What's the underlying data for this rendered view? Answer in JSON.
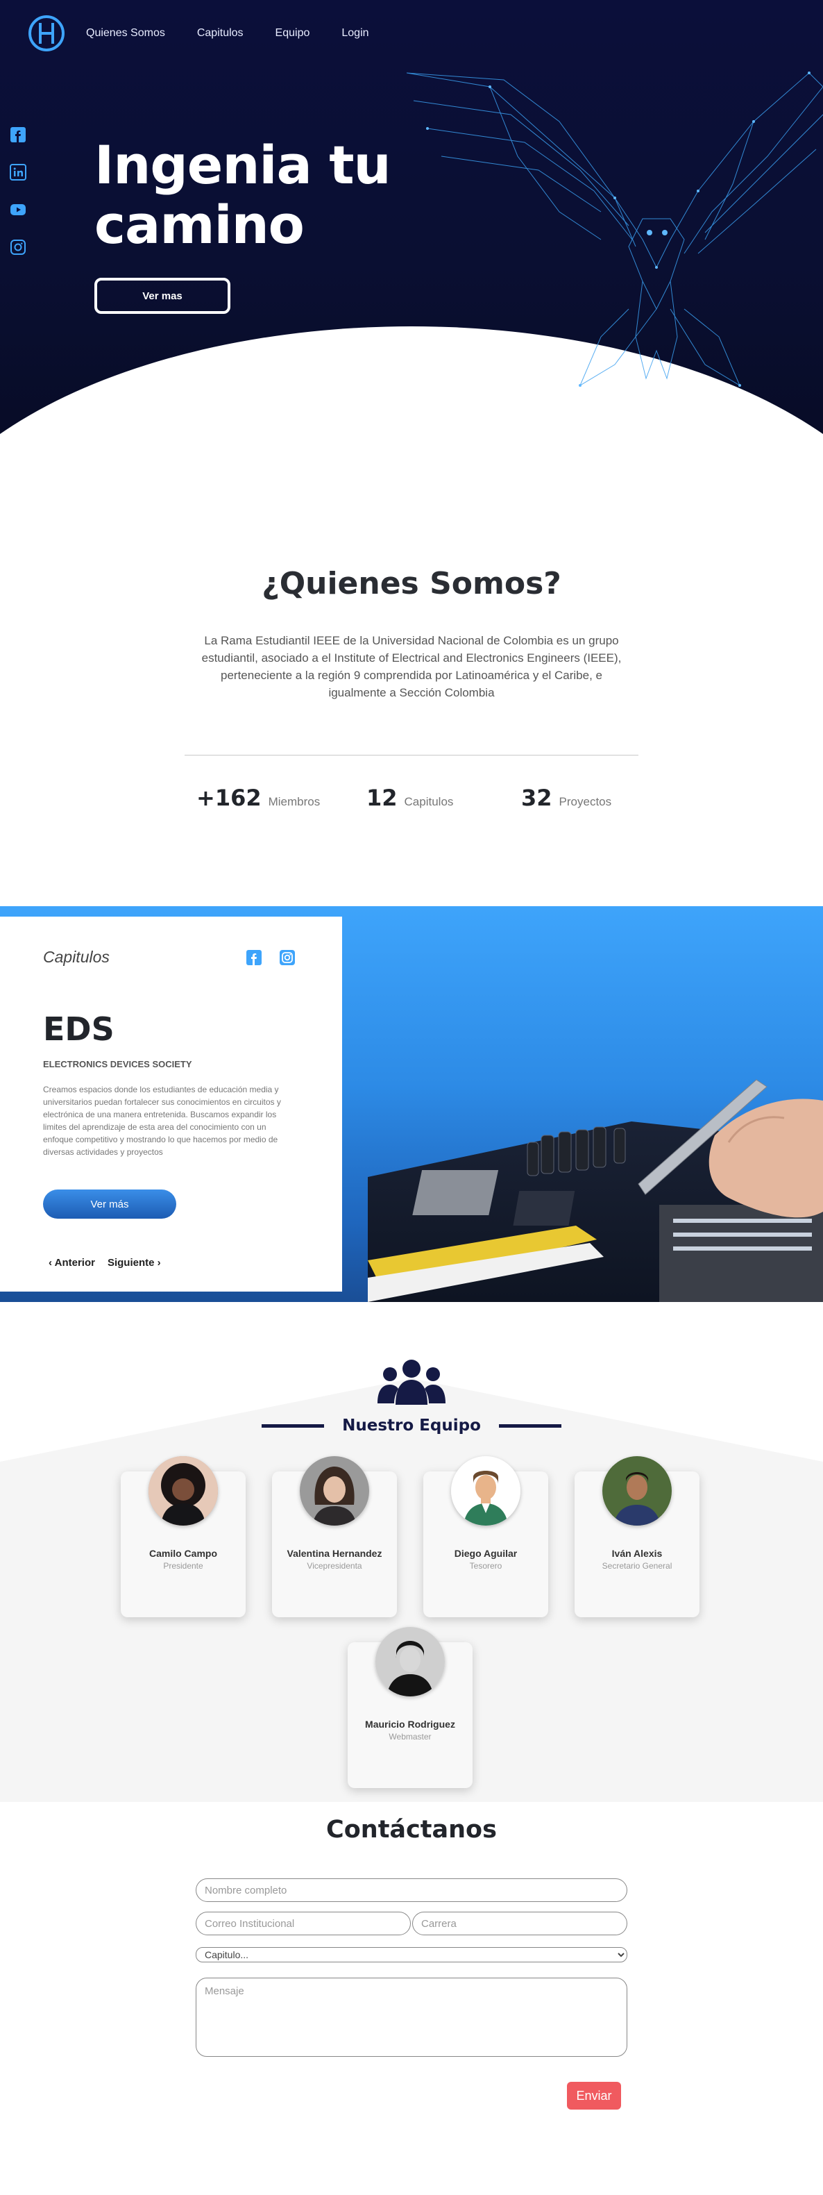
{
  "nav": {
    "logo": "ieee-owl-logo",
    "links": [
      "Quienes Somos",
      "Capitulos",
      "Equipo",
      "Login"
    ]
  },
  "hero": {
    "title_line1": "Ingenia tu",
    "title_line2": "camino",
    "button": "Ver mas",
    "social": [
      "facebook-icon",
      "linkedin-icon",
      "youtube-icon",
      "instagram-icon"
    ]
  },
  "about": {
    "title": "¿Quienes Somos?",
    "text": "La Rama Estudiantil IEEE de la Universidad Nacional de Colombia es un grupo estudiantil, asociado a el Institute of Electrical and Electronics Engineers (IEEE), perteneciente a la región 9 comprendida por Latinoamérica y el Caribe, e igualmente a Sección Colombia",
    "stats": [
      {
        "value": "+162",
        "label": "Miembros"
      },
      {
        "value": "12",
        "label": "Capitulos"
      },
      {
        "value": "32",
        "label": "Proyectos"
      }
    ]
  },
  "chapters": {
    "heading": "Capitulos",
    "name": "EDS",
    "subtitle": "ELECTRONICS DEVICES SOCIETY",
    "description": "Creamos espacios donde los estudiantes de educación media y universitarios puedan fortalecer sus conocimientos en circuitos y electrónica de una manera entretenida. Buscamos expandir los limites del aprendizaje de esta area del conocimiento con un enfoque competitivo y mostrando lo que hacemos por medio de diversas actividades y proyectos",
    "button": "Ver más",
    "prev": "‹ Anterior",
    "next": "Siguiente ›"
  },
  "team": {
    "title": "Nuestro Equipo",
    "members": [
      {
        "name": "Camilo Campo",
        "role": "Presidente"
      },
      {
        "name": "Valentina Hernandez",
        "role": "Vicepresidenta"
      },
      {
        "name": "Diego Aguilar",
        "role": "Tesorero"
      },
      {
        "name": "Iván Alexis",
        "role": "Secretario General"
      },
      {
        "name": "Mauricio Rodriguez",
        "role": "Webmaster"
      }
    ]
  },
  "contact": {
    "title": "Contáctanos",
    "name_placeholder": "Nombre completo",
    "email_placeholder": "Correo Institucional",
    "career_placeholder": "Carrera",
    "select_value": "Capitulo...",
    "message_placeholder": "Mensaje",
    "submit": "Enviar"
  },
  "colors": {
    "hero_bg": "#0b0f3a",
    "accent_blue": "#3ea4fb",
    "team_navy": "#151a45",
    "submit_red": "#f05a5f"
  }
}
